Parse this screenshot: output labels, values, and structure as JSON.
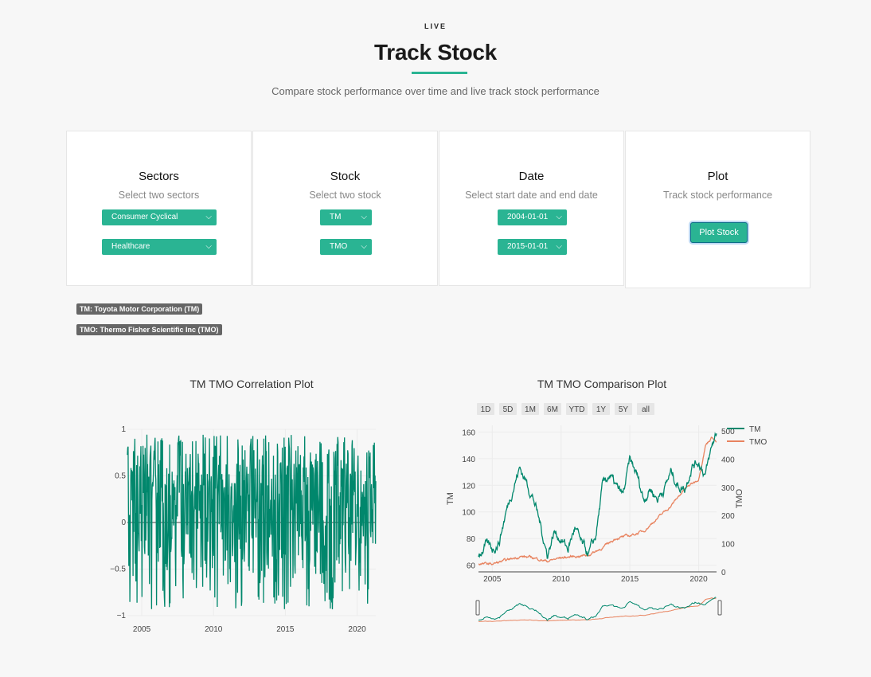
{
  "header": {
    "eyebrow": "LIVE",
    "title": "Track Stock",
    "subtitle": "Compare stock performance over time and live track stock performance",
    "accent": "#2ab493"
  },
  "panels": {
    "sectors": {
      "title": "Sectors",
      "hint": "Select two sectors",
      "select1": "Consumer Cyclical",
      "select2": "Healthcare"
    },
    "stock": {
      "title": "Stock",
      "hint": "Select two stock",
      "select1": "TM",
      "select2": "TMO"
    },
    "date": {
      "title": "Date",
      "hint": "Select start date and end date",
      "select1": "2004-01-01",
      "select2": "2015-01-01"
    },
    "plot": {
      "title": "Plot",
      "hint": "Track stock performance",
      "button": "Plot Stock"
    }
  },
  "badges": {
    "tm": "TM: Toyota Motor Corporation (TM)",
    "tmo": "TMO: Thermo Fisher Scientific Inc (TMO)"
  },
  "chart_data": [
    {
      "type": "line",
      "title": "TM TMO Correlation Plot",
      "color": "#00876c",
      "xlim": [
        2004,
        2021.3
      ],
      "ylim": [
        -1,
        1
      ],
      "xticks": [
        "2005",
        "2010",
        "2015",
        "2020"
      ],
      "xtick_values": [
        2005,
        2010,
        2015,
        2020
      ],
      "yticks": [
        "1",
        "0.5",
        "0",
        "−0.5",
        "−1"
      ],
      "ytick_values": [
        1,
        0.5,
        0,
        -0.5,
        -1
      ],
      "series": [
        {
          "values_note_min": -0.95,
          "values_note_max": 0.97
        }
      ]
    },
    {
      "type": "line",
      "title": "TM TMO Comparison Plot",
      "range_buttons": [
        "1D",
        "5D",
        "1M",
        "6M",
        "YTD",
        "1Y",
        "5Y",
        "all"
      ],
      "xlim": [
        2004,
        2021.3
      ],
      "xticks": [
        "2005",
        "2010",
        "2015",
        "2020"
      ],
      "xtick_values": [
        2005,
        2010,
        2015,
        2020
      ],
      "ylabel": "TM",
      "ylim": [
        55,
        165
      ],
      "yticks": [
        "160",
        "140",
        "120",
        "100",
        "80",
        "60"
      ],
      "ytick_values": [
        160,
        140,
        120,
        100,
        80,
        60
      ],
      "y2label": "TMO",
      "y2lim": [
        0,
        520
      ],
      "y2ticks": [
        "500",
        "400",
        "300",
        "200",
        "100",
        "0"
      ],
      "y2tick_values": [
        500,
        400,
        300,
        200,
        100,
        0
      ],
      "legend": "top-right",
      "series": [
        {
          "name": "TM",
          "color": "#00876c",
          "axis": "y",
          "x": [
            2004,
            2004.5,
            2005,
            2005.5,
            2006,
            2006.5,
            2007,
            2007.5,
            2008,
            2008.5,
            2009,
            2009.5,
            2010,
            2010.5,
            2011,
            2011.5,
            2012,
            2012.5,
            2013,
            2013.5,
            2014,
            2014.5,
            2015,
            2015.5,
            2016,
            2016.5,
            2017,
            2017.5,
            2018,
            2018.5,
            2019,
            2019.5,
            2020,
            2020.5,
            2021,
            2021.3
          ],
          "values": [
            68,
            75,
            72,
            78,
            100,
            118,
            133,
            122,
            110,
            90,
            68,
            85,
            80,
            72,
            88,
            75,
            68,
            80,
            118,
            128,
            118,
            112,
            138,
            128,
            110,
            118,
            110,
            118,
            130,
            120,
            118,
            135,
            138,
            128,
            150,
            160
          ]
        },
        {
          "name": "TMO",
          "color": "#e8835f",
          "axis": "y2",
          "x": [
            2004,
            2005,
            2006,
            2007,
            2008,
            2009,
            2010,
            2011,
            2012,
            2013,
            2014,
            2015,
            2016,
            2017,
            2018,
            2019,
            2020,
            2020.5,
            2021,
            2021.3
          ],
          "values": [
            28,
            28,
            40,
            55,
            50,
            38,
            50,
            55,
            60,
            85,
            120,
            128,
            145,
            190,
            235,
            295,
            330,
            450,
            480,
            460
          ]
        }
      ]
    }
  ]
}
